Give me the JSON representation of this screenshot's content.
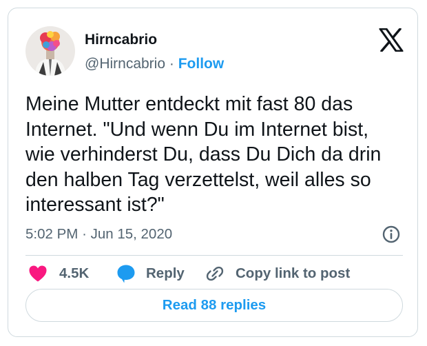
{
  "author": {
    "name": "Hirncabrio",
    "handle": "@Hirncabrio",
    "separator": "·",
    "follow_label": "Follow"
  },
  "tweet": {
    "text": "Meine Mutter entdeckt mit fast 80 das\nInternet. \"Und wenn Du im Internet bist,\nwie verhinderst Du, dass Du Dich da drin\nden halben Tag verzettelst, weil alles so\ninteressant ist?\"",
    "time": "5:02 PM",
    "separator": "·",
    "date": "Jun 15, 2020"
  },
  "actions": {
    "like_count": "4.5K",
    "reply_label": "Reply",
    "copy_label": "Copy link to post"
  },
  "footer": {
    "read_replies_label": "Read 88 replies"
  },
  "icons": {
    "logo": "x-logo-icon",
    "info": "info-icon",
    "like": "heart-icon",
    "reply": "speech-bubble-icon",
    "copy": "link-icon"
  },
  "colors": {
    "accent": "#1d9bf0",
    "like": "#f91880",
    "text": "#0f1419",
    "muted": "#536471",
    "border": "#cfd9de"
  }
}
